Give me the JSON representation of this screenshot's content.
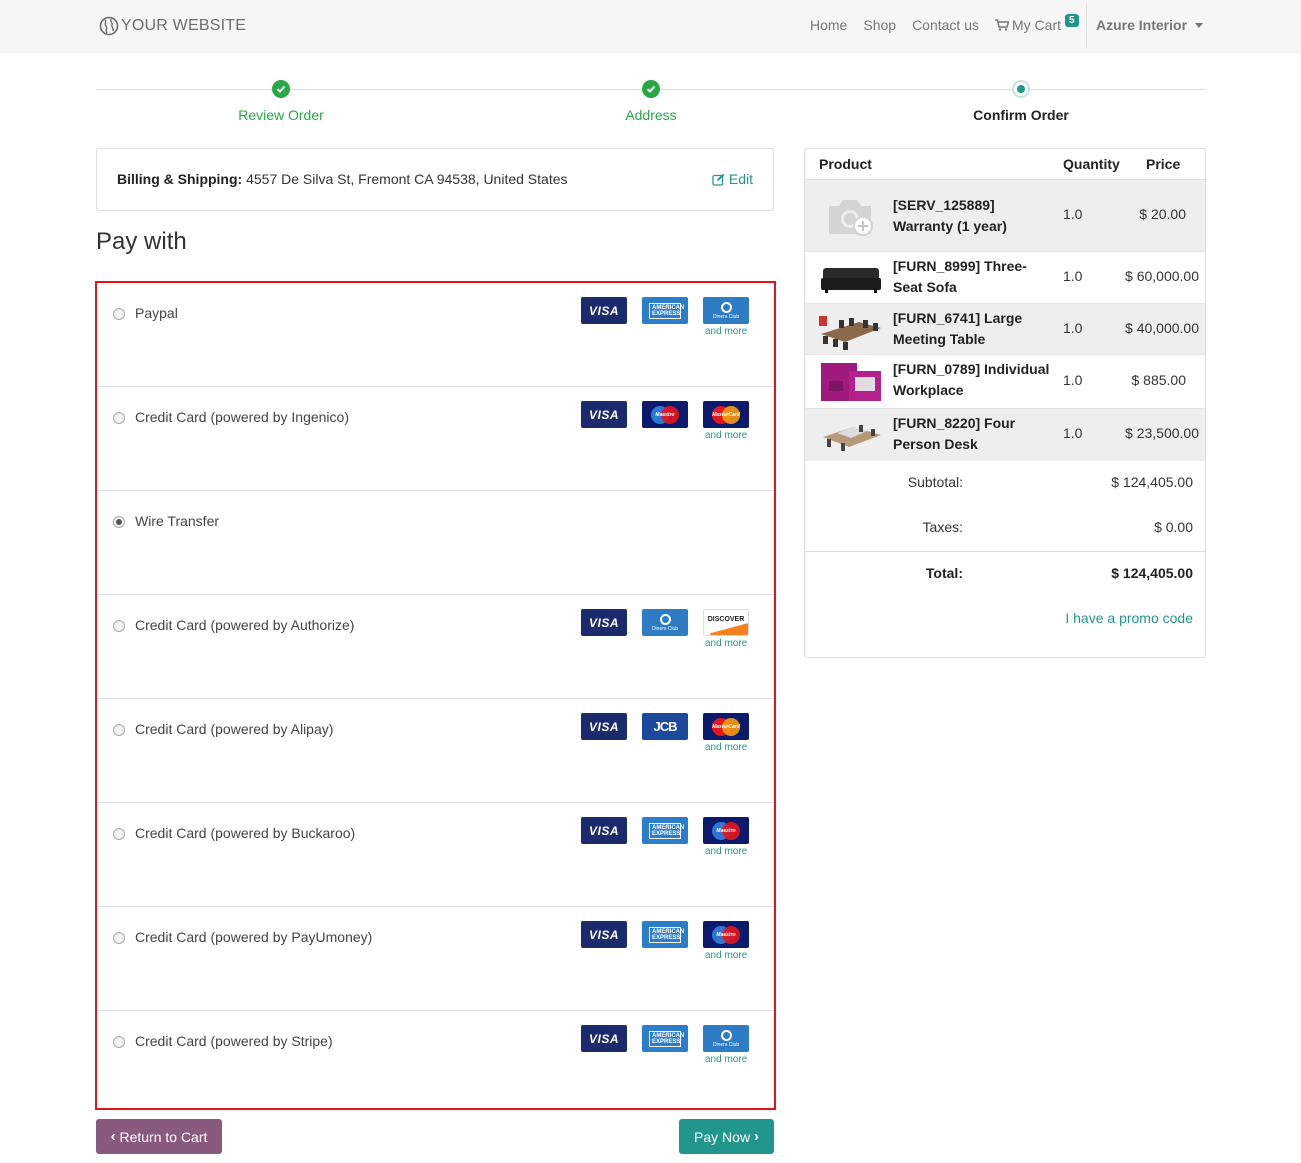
{
  "navbar": {
    "brand": "YOUR WEBSITE",
    "links": [
      "Home",
      "Shop",
      "Contact us"
    ],
    "cart_label": "My Cart",
    "cart_count": "5",
    "user": "Azure Interior"
  },
  "steps": [
    {
      "label": "Review Order",
      "state": "done"
    },
    {
      "label": "Address",
      "state": "done"
    },
    {
      "label": "Confirm Order",
      "state": "current"
    }
  ],
  "billing": {
    "label": "Billing & Shipping:",
    "address": " 4557 De Silva St, Fremont CA 94538, United States",
    "edit_label": "Edit"
  },
  "pay_with_title": "Pay with",
  "payment_methods": [
    {
      "label": "Paypal",
      "checked": false,
      "cards": [
        "visa",
        "amex",
        "diners"
      ],
      "more": "and more"
    },
    {
      "label": "Credit Card (powered by Ingenico)",
      "checked": false,
      "cards": [
        "visa",
        "maestro",
        "mastercard"
      ],
      "more": "and more"
    },
    {
      "label": "Wire Transfer",
      "checked": true,
      "cards": [],
      "more": ""
    },
    {
      "label": "Credit Card (powered by Authorize)",
      "checked": false,
      "cards": [
        "visa",
        "diners",
        "discover"
      ],
      "more": "and more"
    },
    {
      "label": "Credit Card (powered by Alipay)",
      "checked": false,
      "cards": [
        "visa",
        "jcb",
        "mastercard"
      ],
      "more": "and more"
    },
    {
      "label": "Credit Card (powered by Buckaroo)",
      "checked": false,
      "cards": [
        "visa",
        "amex",
        "maestro"
      ],
      "more": "and more"
    },
    {
      "label": "Credit Card (powered by PayUmoney)",
      "checked": false,
      "cards": [
        "visa",
        "amex",
        "maestro"
      ],
      "more": "and more"
    },
    {
      "label": "Credit Card (powered by Stripe)",
      "checked": false,
      "cards": [
        "visa",
        "amex",
        "diners"
      ],
      "more": "and more"
    }
  ],
  "card_texts": {
    "visa": "VISA",
    "amex": "AMERICAN EXPRESS",
    "diners": "Diners Club",
    "maestro": "Maestro",
    "mastercard": "MasterCard",
    "discover": "DISCOVER",
    "jcb": "JCB"
  },
  "buttons": {
    "return": "Return to Cart",
    "pay": "Pay Now"
  },
  "order": {
    "headers": {
      "product": "Product",
      "quantity": "Quantity",
      "price": "Price"
    },
    "items": [
      {
        "name": "[SERV_125889] Warranty (1 year)",
        "qty": "1.0",
        "price": "$ 20.00",
        "thumb": "camera-placeholder-icon"
      },
      {
        "name": "[FURN_8999] Three-Seat Sofa",
        "qty": "1.0",
        "price": "$ 60,000.00",
        "thumb": "sofa-image"
      },
      {
        "name": "[FURN_6741] Large Meeting Table",
        "qty": "1.0",
        "price": "$ 40,000.00",
        "thumb": "meeting-table-image"
      },
      {
        "name": "[FURN_0789] Individual Workplace",
        "qty": "1.0",
        "price": "$ 885.00",
        "thumb": "workplace-image"
      },
      {
        "name": "[FURN_8220] Four Person Desk",
        "qty": "1.0",
        "price": "$ 23,500.00",
        "thumb": "desk-image"
      }
    ],
    "subtotal_label": "Subtotal:",
    "subtotal": "$ 124,405.00",
    "taxes_label": "Taxes:",
    "taxes": "$ 0.00",
    "total_label": "Total:",
    "total": "$ 124,405.00",
    "promo": "I have a promo code"
  },
  "colors": {
    "accent": "#21968b",
    "success": "#28a745",
    "return_button": "#8a5a7e",
    "highlight_border": "#e0141e"
  }
}
